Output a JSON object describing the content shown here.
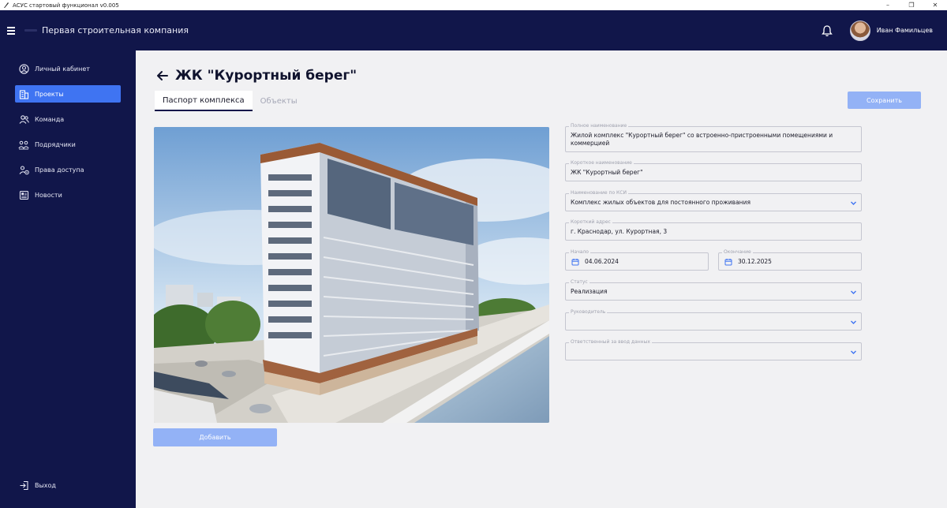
{
  "window": {
    "title": "АСУС стартовый функционал v0.005",
    "minimize": "–",
    "maximize": "❐",
    "close": "✕"
  },
  "header": {
    "company": "Первая строительная компания",
    "user_name": "Иван Фамильцев",
    "icons": [
      "menu-icon",
      "bell-icon",
      "avatar"
    ]
  },
  "sidebar": {
    "items": [
      {
        "label": "Личный кабинет",
        "icon": "user-circle-icon",
        "active": false
      },
      {
        "label": "Проекты",
        "icon": "building-icon",
        "active": true
      },
      {
        "label": "Команда",
        "icon": "team-icon",
        "active": false
      },
      {
        "label": "Подрядчики",
        "icon": "contractors-icon",
        "active": false
      },
      {
        "label": "Права доступа",
        "icon": "access-icon",
        "active": false
      },
      {
        "label": "Новости",
        "icon": "news-icon",
        "active": false
      }
    ],
    "logout": "Выход"
  },
  "page": {
    "title": "ЖК \"Курортный берег\"",
    "tabs": [
      {
        "label": "Паспорт комплекса",
        "active": true
      },
      {
        "label": "Объекты",
        "active": false
      }
    ],
    "save_label": "Сохранить",
    "add_label": "Добавить"
  },
  "form": {
    "full_name": {
      "label": "Полное наименование",
      "value": "Жилой комплекс \"Курортный берег\" со встроенно-пристроенными помещениями и коммерцией"
    },
    "short_name": {
      "label": "Короткое наименование",
      "value": "ЖК \"Курортный берег\""
    },
    "ksi_name": {
      "label": "Наименование по КСИ",
      "value": "Комплекс жилых объектов для постоянного проживания"
    },
    "short_address": {
      "label": "Короткий адрес",
      "value": "г. Краснодар, ул. Курортная, 3"
    },
    "start": {
      "label": "Начало",
      "value": "04.06.2024"
    },
    "end": {
      "label": "Окончание",
      "value": "30.12.2025"
    },
    "status": {
      "label": "Статус",
      "value": "Реализация"
    },
    "manager": {
      "label": "Руководитель",
      "value": ""
    },
    "data_responsible": {
      "label": "Ответственный за ввод данных",
      "value": ""
    }
  },
  "colors": {
    "nav_bg": "#11164a",
    "accent": "#3f74f2",
    "disabled_button": "#93b2f6",
    "page_bg": "#f1f1f3"
  }
}
